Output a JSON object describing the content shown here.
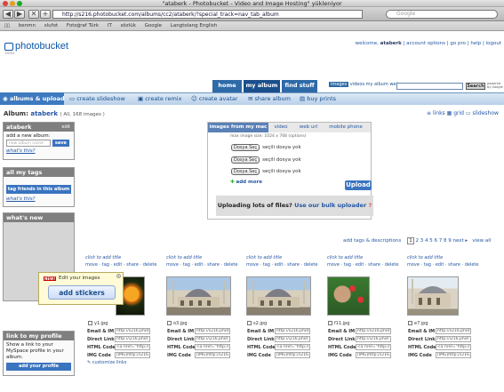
{
  "window": {
    "title": "\"ataberk - Photobucket - Video and Image Hosting\" yükleniyor"
  },
  "browser": {
    "url": "http://s216.photobucket.com/albums/cc2/ataberk/?special_track=nav_tab_album",
    "search_placeholder": "Google",
    "back": "◀",
    "forward": "▶",
    "stop": "✕",
    "add": "+"
  },
  "bookmarks": [
    "benmn",
    "slufot",
    "Fotoğraf Türk",
    "IT",
    "sözlük",
    "Google",
    "Langtolang English"
  ],
  "header": {
    "logo": "photobucket",
    "welcome_label": "welcome,",
    "username": "ataberk",
    "links": [
      "account options",
      "go pro",
      "help",
      "logout"
    ],
    "version": "beta"
  },
  "tabs": [
    "home",
    "my album",
    "find stuff"
  ],
  "search": {
    "types": [
      "images",
      "videos",
      "my album",
      "web"
    ],
    "button": "Search",
    "powered": "powered by Google"
  },
  "actions": [
    "albums & upload",
    "create slideshow",
    "create remix",
    "create avatar",
    "share album",
    "buy prints"
  ],
  "album": {
    "label": "Album:",
    "name": "ataberk",
    "count": "( All, 168 images )",
    "views": [
      "links",
      "grid",
      "slideshow"
    ]
  },
  "sidebar": {
    "album_box": {
      "title": "ataberk",
      "edit": "edit",
      "add_label": "add a new album:",
      "placeholder": "new album name",
      "save": "save",
      "whats": "what's this?"
    },
    "tags_box": {
      "title": "all my tags",
      "button": "tag friends in this album",
      "whats": "what's this?"
    },
    "new_box": {
      "title": "what's new"
    },
    "profile_box": {
      "title": "link to my profile",
      "text": "Show a link to your MySpace profile in your album.",
      "button": "add your profile"
    }
  },
  "upload": {
    "tabs": [
      "images from my mac",
      "video",
      "web url",
      "mobile phone"
    ],
    "max_size": "max image size: 1024 x 768 (options)",
    "rows": [
      {
        "btn": "Dosya Seç",
        "text": "seçili dosya yok"
      },
      {
        "btn": "Dosya Seç",
        "text": "seçili dosya yok"
      },
      {
        "btn": "Dosya Seç",
        "text": "seçili dosya yok"
      }
    ],
    "add_more": "add more",
    "upload_btn": "Upload",
    "bulk_text": "Uploading lots of files?",
    "bulk_link": "Use our bulk uploader"
  },
  "pager": {
    "tags": "add tags & descriptions",
    "current": "1",
    "pages": [
      "2",
      "3",
      "4",
      "5",
      "6",
      "7",
      "8",
      "9"
    ],
    "next": "next",
    "view": "view all"
  },
  "grid": {
    "click_title": "click to add title",
    "action_links": "move · tag · edit · share · delete",
    "items": [
      {
        "file": "y1.jpg"
      },
      {
        "file": "o3.jpg"
      },
      {
        "file": "s2.jpg"
      },
      {
        "file": "f11.jpg"
      },
      {
        "file": "e7.jpg"
      }
    ],
    "code_labels": [
      "Email & IM",
      "Direct Link",
      "HTML Code",
      "IMG Code"
    ],
    "code_values": [
      "http://s216.phot",
      "http://i216.phot",
      "<a href=\"http://",
      "[IMG]http://i216."
    ],
    "customize": "customize links"
  },
  "tooltip": {
    "new": "NEW!",
    "text": "Edit your images",
    "button": "add stickers",
    "close": "x"
  }
}
